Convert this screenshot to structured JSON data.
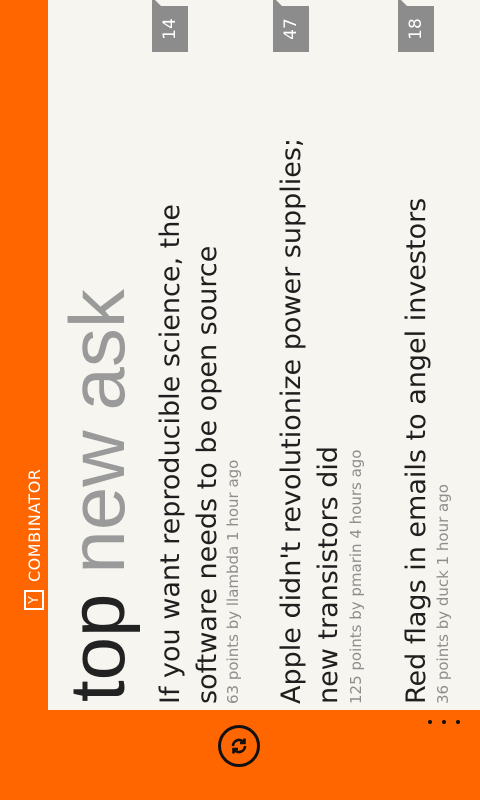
{
  "brand": {
    "logo_letter": "Y",
    "name": "COMBINATOR",
    "color": "#ff6600"
  },
  "pivot": {
    "tabs": [
      {
        "label": "top",
        "active": true
      },
      {
        "label": "new",
        "active": false
      },
      {
        "label": "ask",
        "active": false
      }
    ]
  },
  "items": [
    {
      "title": "If you want reproducible science, the software needs to be open source",
      "meta": "63 points by llambda 1 hour ago",
      "comments": "14"
    },
    {
      "title": "Apple didn't revolutionize power supplies; new transistors did",
      "meta": "125 points by pmarin 4 hours ago",
      "comments": "47"
    },
    {
      "title": "Red flags in emails to angel investors",
      "meta": "36 points by duck 1 hour ago",
      "comments": "18"
    }
  ],
  "appbar": {
    "refresh_icon": "refresh-icon",
    "more_icon": "ellipsis-icon"
  }
}
